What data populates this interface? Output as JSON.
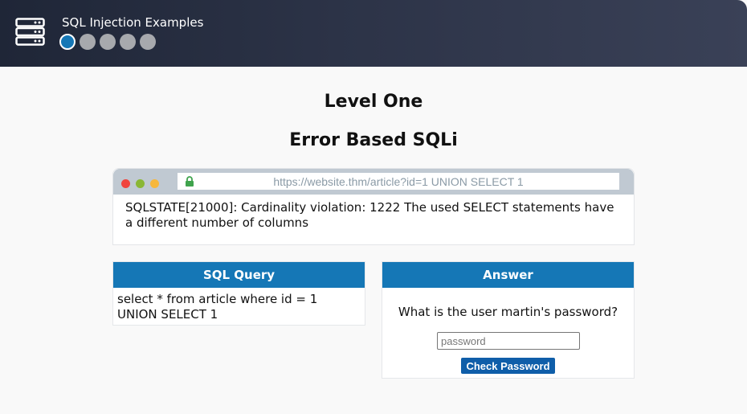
{
  "header": {
    "app_title": "SQL Injection Examples",
    "icon": "server-icon",
    "steps": [
      {
        "state": "active"
      },
      {
        "state": "inactive"
      },
      {
        "state": "inactive"
      },
      {
        "state": "inactive"
      },
      {
        "state": "inactive"
      }
    ]
  },
  "level": {
    "title": "Level One",
    "subtitle": "Error Based SQLi"
  },
  "browser": {
    "url": "https://website.thm/article?id=1 UNION SELECT 1",
    "output": "SQLSTATE[21000]: Cardinality violation: 1222 The used SELECT statements have a different number of columns"
  },
  "sql_query": {
    "heading": "SQL Query",
    "text": "select * from article where id = 1 UNION SELECT 1"
  },
  "answer": {
    "heading": "Answer",
    "question": "What is the user martin's password?",
    "input_value": "",
    "input_placeholder": "password",
    "button_label": "Check Password"
  },
  "colors": {
    "accent": "#1577b6",
    "button": "#0f5ea9",
    "header_bg": "#2c3347"
  }
}
